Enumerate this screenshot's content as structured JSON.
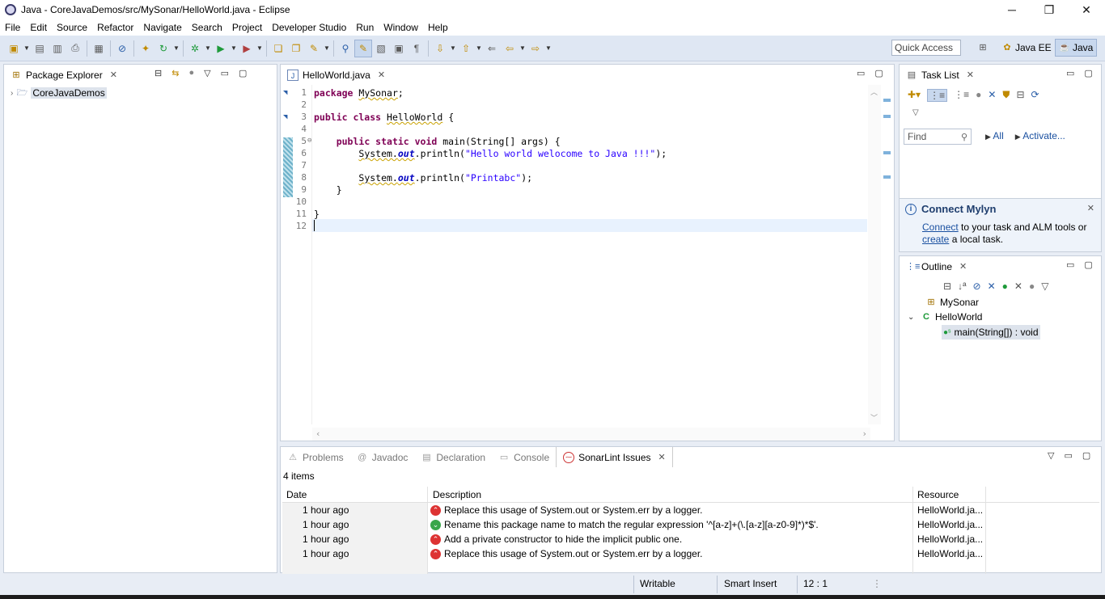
{
  "window": {
    "title": "Java - CoreJavaDemos/src/MySonar/HelloWorld.java - Eclipse",
    "minimize": "─",
    "restore": "❐",
    "close": "✕"
  },
  "menu": [
    "File",
    "Edit",
    "Source",
    "Refactor",
    "Navigate",
    "Search",
    "Project",
    "Developer Studio",
    "Run",
    "Window",
    "Help"
  ],
  "toolbar": {
    "quick_access_placeholder": "Quick Access",
    "perspectives": [
      "Java EE",
      "Java"
    ]
  },
  "package_explorer": {
    "tab": "Package Explorer",
    "project": "CoreJavaDemos"
  },
  "editor": {
    "tab": "HelloWorld.java",
    "lines": [
      "1",
      "2",
      "3",
      "4",
      "5",
      "6",
      "7",
      "8",
      "9",
      "10",
      "11",
      "12"
    ],
    "code": {
      "l1_kw": "package",
      "l1_pkg": "MySonar",
      "l1_end": ";",
      "l3_kw": "public class",
      "l3_name": "HelloWorld",
      "l3_end": " {",
      "l5_kw": "public static void",
      "l5_rest": " main(String[] args) {",
      "l6_obj": "System.",
      "l6_fld": "out",
      "l6_call": ".println(",
      "l6_str": "\"Hello world welocome to Java !!!\"",
      "l6_end": ");",
      "l8_obj": "System.",
      "l8_fld": "out",
      "l8_call": ".println(",
      "l8_str": "\"Printabc\"",
      "l8_end": ");",
      "l9": "}",
      "l11": "}"
    }
  },
  "task_list": {
    "tab": "Task List",
    "find_placeholder": "Find",
    "all": "All",
    "activate": "Activate..."
  },
  "mylyn": {
    "title": "Connect Mylyn",
    "connect_link": "Connect",
    "text1": " to your task and ALM tools or",
    "create_link": "create",
    "text2": " a local task."
  },
  "outline": {
    "tab": "Outline",
    "items": [
      "MySonar",
      "HelloWorld",
      "main(String[]) : void"
    ]
  },
  "bottom": {
    "tabs": [
      "Problems",
      "Javadoc",
      "Declaration",
      "Console",
      "SonarLint Issues"
    ],
    "item_count": "4 items",
    "columns": [
      "Date",
      "Description",
      "Resource"
    ],
    "rows": [
      {
        "date": "1 hour ago",
        "severity": "red",
        "description": "Replace this usage of System.out or System.err by a logger.",
        "resource": "HelloWorld.ja..."
      },
      {
        "date": "1 hour ago",
        "severity": "green",
        "description": "Rename this package name to match the regular expression '^[a-z]+(\\.[a-z][a-z0-9]*)*$'.",
        "resource": "HelloWorld.ja..."
      },
      {
        "date": "1 hour ago",
        "severity": "red",
        "description": "Add a private constructor to hide the implicit public one.",
        "resource": "HelloWorld.ja..."
      },
      {
        "date": "1 hour ago",
        "severity": "red",
        "description": "Replace this usage of System.out or System.err by a logger.",
        "resource": "HelloWorld.ja..."
      }
    ]
  },
  "statusbar": {
    "writable": "Writable",
    "insert_mode": "Smart Insert",
    "position": "12 : 1"
  }
}
